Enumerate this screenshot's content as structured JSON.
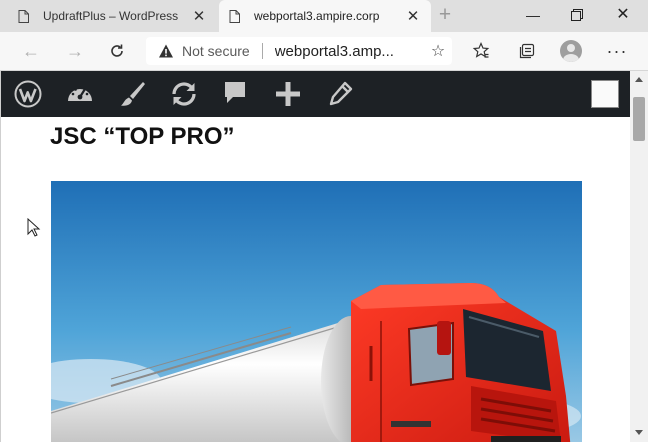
{
  "browser": {
    "tabs": [
      {
        "title": "UpdraftPlus – WordPress",
        "active": false
      },
      {
        "title": "webportal3.ampire.corp",
        "active": true
      }
    ],
    "address_bar": {
      "security_label": "Not secure",
      "url": "webportal3.amp..."
    },
    "icons": {
      "back": "arrow-left-icon",
      "forward": "arrow-right-icon",
      "reload": "reload-icon",
      "favorites": "favorites-icon",
      "collections": "collections-icon",
      "profile": "profile-avatar",
      "more": "more-icon"
    }
  },
  "admin_bar": {
    "items": [
      "wordpress-logo-icon",
      "dashboard-icon",
      "customize-brush-icon",
      "updates-icon",
      "comments-icon",
      "new-plus-icon",
      "edit-pencil-icon"
    ]
  },
  "page": {
    "title": "JSC “TOP PRO”",
    "hero_image": "red-tanker-truck-under-blue-sky"
  },
  "colors": {
    "admin_bar_bg": "#1d2125",
    "tab_strip_bg": "#dfdfdf",
    "truck_red": "#e52b1b",
    "sky_blue": "#2f88c8"
  }
}
